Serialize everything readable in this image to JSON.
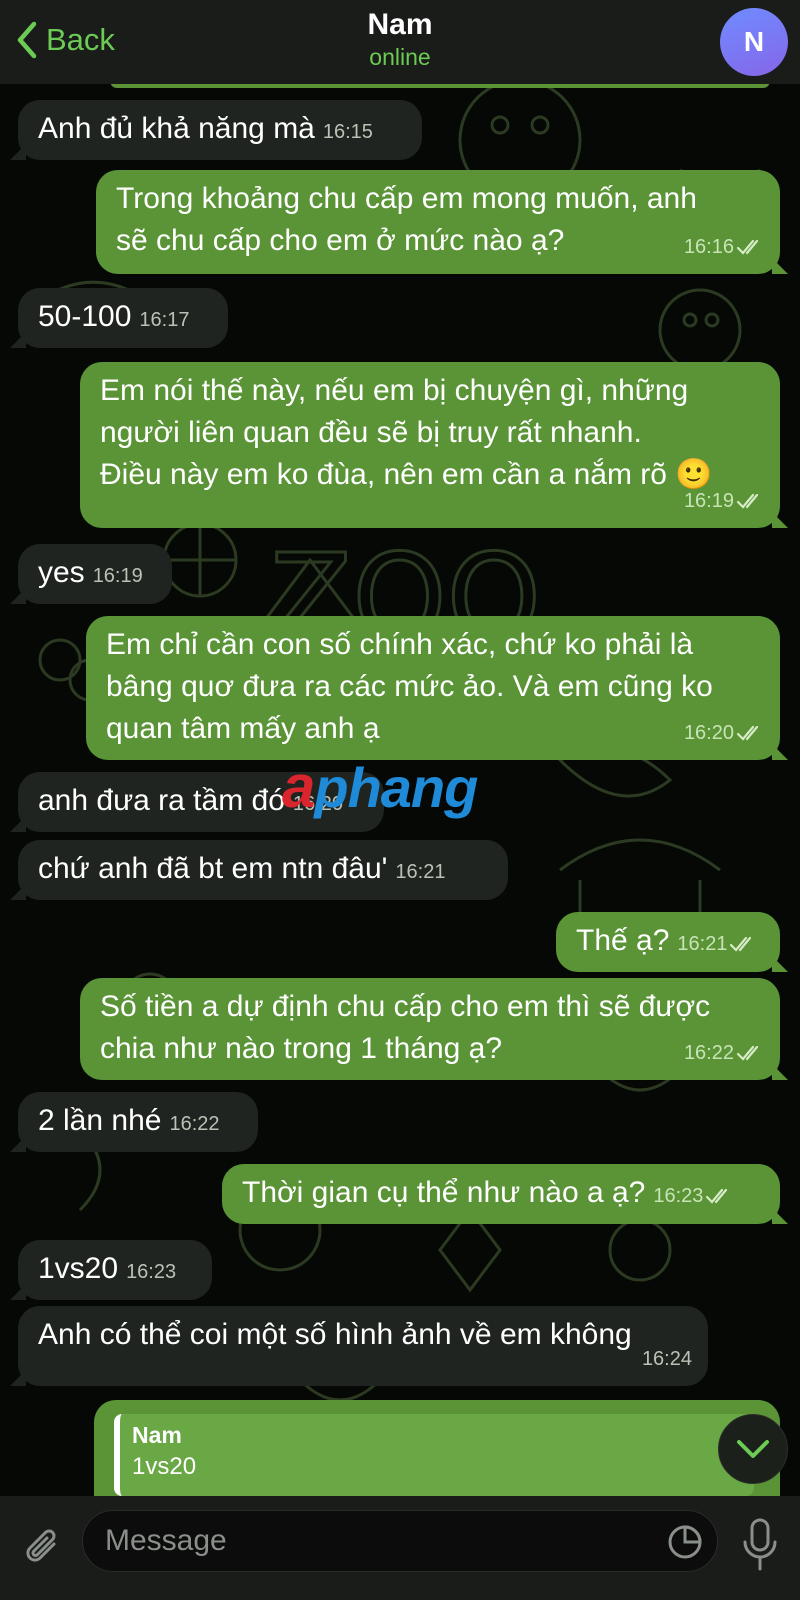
{
  "header": {
    "back_label": "Back",
    "contact_name": "Nam",
    "status": "online",
    "avatar_initial": "N"
  },
  "messages": [
    {
      "dir": "in",
      "text": "Anh đủ khả năng mà",
      "time": "16:15"
    },
    {
      "dir": "out",
      "lines": [
        "Trong khoảng chu cấp em mong muốn, anh",
        "sẽ chu cấp cho em ở mức nào ạ?"
      ],
      "time": "16:16"
    },
    {
      "dir": "in",
      "text": "50-100",
      "time": "16:17"
    },
    {
      "dir": "out",
      "lines": [
        "Em nói thế này, nếu em bị chuyện gì, những",
        "người liên quan đều sẽ bị truy rất nhanh.",
        "Điều này em ko đùa, nên em cần a nắm rõ 🙂"
      ],
      "time": "16:19"
    },
    {
      "dir": "in",
      "text": "yes",
      "time": "16:19"
    },
    {
      "dir": "out",
      "lines": [
        "Em chỉ cần con số chính xác, chứ ko phải là",
        "bâng quơ đưa ra các mức ảo. Và em cũng ko",
        "quan tâm mấy anh ạ"
      ],
      "time": "16:20"
    },
    {
      "dir": "in",
      "text": "anh đưa ra tầm đó",
      "time": "16:20"
    },
    {
      "dir": "in",
      "text": "chứ anh đã bt em ntn đâu'",
      "time": "16:21"
    },
    {
      "dir": "out",
      "text": "Thế ạ?",
      "time": "16:21"
    },
    {
      "dir": "out",
      "lines": [
        "Số tiền a dự định chu cấp cho em thì sẽ được",
        "chia như nào trong 1 tháng ạ?"
      ],
      "time": "16:22"
    },
    {
      "dir": "in",
      "text": "2 lần nhé",
      "time": "16:22"
    },
    {
      "dir": "out",
      "text": "Thời gian cụ thể như nào a ạ?",
      "time": "16:23"
    },
    {
      "dir": "in",
      "text": "1vs20",
      "time": "16:23"
    },
    {
      "dir": "in",
      "text": "Anh có thể coi một số hình ảnh về em không",
      "time": "16:24"
    }
  ],
  "reply_preview": {
    "name": "Nam",
    "text": "1vs20"
  },
  "watermark": {
    "first": "a",
    "rest": "phang"
  },
  "input": {
    "placeholder": "Message"
  },
  "colors": {
    "accent": "#6ccb54",
    "outgoing": "#5a9436",
    "incoming": "#1f2420",
    "header": "#1a1c1a"
  }
}
